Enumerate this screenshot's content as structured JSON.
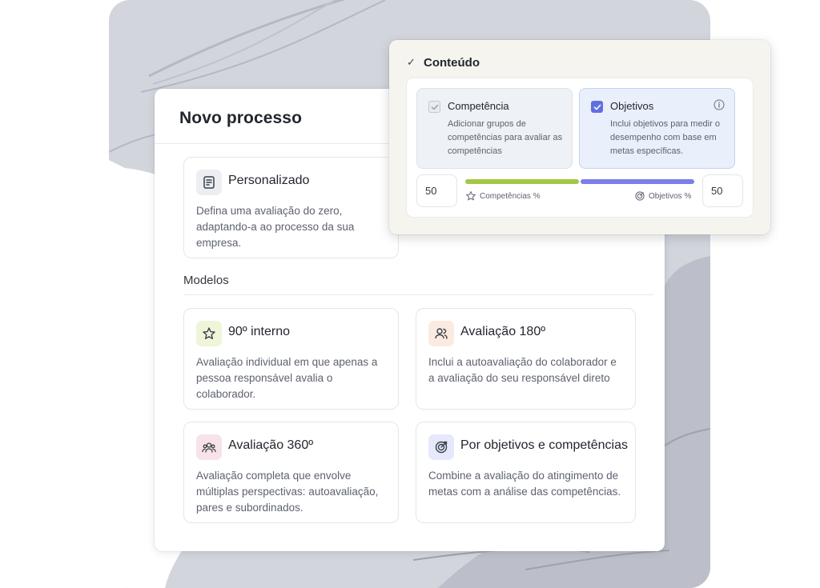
{
  "main": {
    "title": "Novo processo",
    "custom": {
      "title": "Personalizado",
      "description": "Defina uma avaliação do zero, adaptando-a ao processo da sua empresa."
    },
    "models_label": "Modelos",
    "models": [
      {
        "title": "90º interno",
        "description": "Avaliação individual em que apenas a pessoa responsável avalia o colaborador.",
        "icon": "star-icon",
        "icon_bg": "#eef5d9"
      },
      {
        "title": "Avaliação 180º",
        "description": "Inclui a autoavaliação do colaborador e a avaliação do seu responsável direto",
        "icon": "users-icon",
        "icon_bg": "#fbeadf"
      },
      {
        "title": "Avaliação 360º",
        "description": "Avaliação completa que envolve múltiplas perspectivas: autoavaliação, pares e subordinados.",
        "icon": "group-icon",
        "icon_bg": "#f8e3ea"
      },
      {
        "title": "Por objetivos e competências",
        "description": "Combine a avaliação do atingimento de metas com a análise das competências.",
        "icon": "target-icon",
        "icon_bg": "#e6e9fb"
      }
    ]
  },
  "content_panel": {
    "title": "Conteúdo",
    "competencia": {
      "title": "Competência",
      "description": "Adicionar grupos de competências para avaliar as competências",
      "checked": true
    },
    "objetivos": {
      "title": "Objetivos",
      "description": "Inclui objetivos para medir o desempenho com base em metas específicas.",
      "checked": true
    },
    "competencias_value": "50",
    "objetivos_value": "50",
    "competencias_label": "Competências %",
    "objetivos_label": "Objetivos %",
    "competencias_share": 0.5,
    "objetivos_share": 0.5,
    "colors": {
      "green": "#a5c643",
      "blue": "#7a7fea",
      "accent": "#5f6fe0"
    }
  }
}
